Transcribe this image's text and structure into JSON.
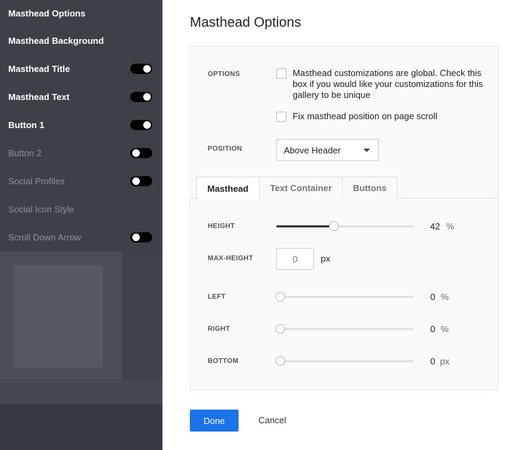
{
  "sidebar": {
    "items": [
      {
        "label": "Masthead Options",
        "toggle": null,
        "dim": false
      },
      {
        "label": "Masthead Background",
        "toggle": null,
        "dim": false
      },
      {
        "label": "Masthead Title",
        "toggle": "on",
        "dim": false
      },
      {
        "label": "Masthead Text",
        "toggle": "on",
        "dim": false
      },
      {
        "label": "Button 1",
        "toggle": "on",
        "dim": false
      },
      {
        "label": "Button 2",
        "toggle": "off",
        "dim": true
      },
      {
        "label": "Social Profiles",
        "toggle": "off",
        "dim": true
      },
      {
        "label": "Social Icon Style",
        "toggle": null,
        "dim": true
      },
      {
        "label": "Scroll Down Arrow",
        "toggle": "off",
        "dim": true
      }
    ]
  },
  "dialog": {
    "title": "Masthead Options",
    "options_label": "OPTIONS",
    "global_checkbox_text": "Masthead customizations are global. Check this box if you would like your customizations for this gallery to be unique",
    "fix_checkbox_text": "Fix masthead position on page scroll",
    "position_label": "POSITION",
    "position_value": "Above Header",
    "tabs": [
      "Masthead",
      "Text Container",
      "Buttons"
    ],
    "active_tab": "Masthead",
    "height": {
      "label": "HEIGHT",
      "value": "42",
      "unit": "%",
      "fraction": 0.42
    },
    "max_height": {
      "label": "MAX-HEIGHT",
      "placeholder": "0",
      "unit": "px"
    },
    "left": {
      "label": "LEFT",
      "value": "0",
      "unit": "%"
    },
    "right": {
      "label": "RIGHT",
      "value": "0",
      "unit": "%"
    },
    "bottom": {
      "label": "BOTTOM",
      "value": "0",
      "unit": "px"
    },
    "done_label": "Done",
    "cancel_label": "Cancel"
  },
  "colors": {
    "accent": "#1a73e8",
    "sidebar_bg": "#41464d"
  }
}
